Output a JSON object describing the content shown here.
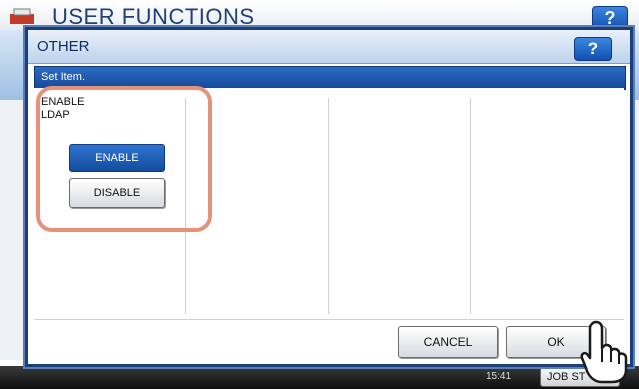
{
  "background": {
    "title": "USER FUNCTIONS",
    "help_label": "?",
    "time": "15:41",
    "job_status_label": "JOB ST"
  },
  "dialog": {
    "title": "OTHER",
    "help_label": "?",
    "subtitle": "Set Item.",
    "item": {
      "label_line1": "ENABLE",
      "label_line2": "LDAP",
      "options": [
        "ENABLE",
        "DISABLE"
      ],
      "selected": "ENABLE"
    },
    "cancel_label": "CANCEL",
    "ok_label": "OK"
  },
  "colors": {
    "accent": "#1650a8",
    "highlight": "#e4937a"
  },
  "icons": {
    "app": "printer-icon",
    "pointer": "hand-pointer-icon"
  }
}
